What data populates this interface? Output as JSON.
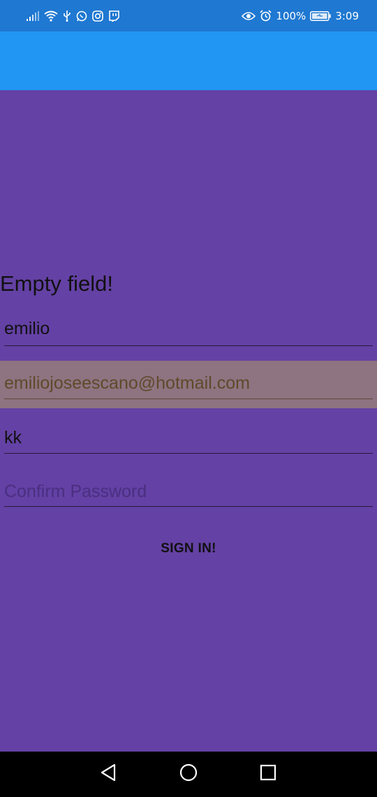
{
  "status_bar": {
    "battery_percent": "100%",
    "time": "3:09",
    "icons_left": [
      "signal-icon",
      "wifi-icon",
      "usb-icon",
      "whatsapp-icon",
      "instagram-icon",
      "twitch-icon"
    ],
    "icons_right": [
      "eye-icon",
      "alarm-icon",
      "battery-icon"
    ]
  },
  "form": {
    "error_message": "Empty field!",
    "name_value": "emilio",
    "email_value": "emiliojoseescano@hotmail.com",
    "password_value": "kk",
    "confirm_password_placeholder": "Confirm Password",
    "sign_in_label": "SIGN IN!"
  },
  "colors": {
    "status_bar": "#1f78d1",
    "app_bar": "#2196f3",
    "background": "#6441a5",
    "email_highlight": "#8e7381",
    "email_text": "#5e4a2a",
    "placeholder": "#4a2f80",
    "nav_bar": "#000000"
  },
  "nav_bar": {
    "buttons": [
      "back-icon",
      "home-icon",
      "recents-icon"
    ]
  }
}
